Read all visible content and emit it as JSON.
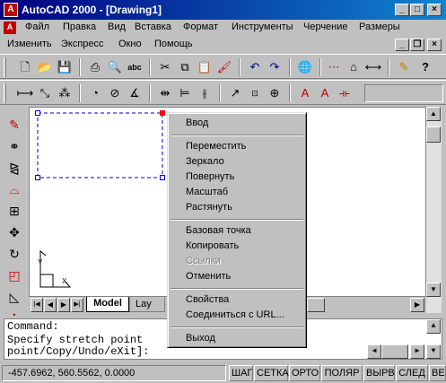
{
  "window": {
    "title": "AutoCAD 2000 - [Drawing1]",
    "logo_text": "A",
    "minimize": "_",
    "maximize": "□",
    "close": "×",
    "doc_minimize": "_",
    "doc_restore": "❐",
    "doc_close": "×"
  },
  "menu_row1": [
    "Файл",
    "Правка",
    "Вид",
    "Вставка",
    "Формат",
    "Инструменты",
    "Черчение",
    "Размеры"
  ],
  "menu_row2": [
    "Изменить",
    "Экспресс",
    "Окно",
    "Помощь"
  ],
  "toolbar1_icons": [
    "new-icon",
    "open-icon",
    "save-icon",
    "print-icon",
    "preview-icon",
    "spell-icon",
    "cut-icon",
    "copy-icon",
    "paste-icon",
    "matchprop-icon",
    "undo-icon",
    "redo-icon",
    "hyperlink-icon",
    "tracking-icon",
    "snap-icon",
    "distance-icon",
    "pencil-icon",
    "help-icon"
  ],
  "toolbar2_icons": [
    "dim-linear-icon",
    "dim-aligned-icon",
    "dim-ordinate-icon",
    "dim-radius-icon",
    "dim-diameter-icon",
    "dim-angular-icon",
    "dim-quick-icon",
    "dim-baseline-icon",
    "dim-continue-icon",
    "leader-icon",
    "tolerance-icon",
    "center-mark-icon",
    "dim-edit-icon",
    "dim-text-edit-icon",
    "dim-update-icon"
  ],
  "left_icons": [
    "erase-icon",
    "copy-object-icon",
    "mirror-icon",
    "offset-icon",
    "array-icon",
    "move-icon",
    "rotate-icon",
    "scale-icon",
    "stretch-icon",
    "lengthen-icon"
  ],
  "tabs": {
    "model": "Model",
    "layout": "Lay"
  },
  "command_lines": [
    "Command:",
    "Specify stretch point",
    "point/Copy/Undo/eXit]:"
  ],
  "status": {
    "coords": "-457.6962, 560.5562, 0.0000",
    "buttons": [
      "ШАГ",
      "СЕТКА",
      "ОРТО",
      "ПОЛЯР",
      "ВЫРВ",
      "СЛЕД",
      "ВЕ"
    ]
  },
  "context_menu": {
    "items": [
      {
        "label": "Ввод",
        "disabled": false
      },
      {
        "label": "Переместить",
        "disabled": false
      },
      {
        "label": "Зеркало",
        "disabled": false
      },
      {
        "label": "Повернуть",
        "disabled": false
      },
      {
        "label": "Масштаб",
        "disabled": false
      },
      {
        "label": "Растянуть",
        "disabled": false
      },
      {
        "label": "Базовая точка",
        "disabled": false
      },
      {
        "label": "Копировать",
        "disabled": false
      },
      {
        "label": "Ссылки",
        "disabled": true
      },
      {
        "label": "Отменить",
        "disabled": false
      },
      {
        "label": "Свойства",
        "disabled": false
      },
      {
        "label": "Соединиться с URL...",
        "disabled": false
      },
      {
        "label": "Выход",
        "disabled": false
      }
    ]
  },
  "colors": {
    "title_start": "#000080",
    "title_end": "#1084d0",
    "grip_hot": "#ff0000",
    "grip_cold": "#0000ff"
  }
}
